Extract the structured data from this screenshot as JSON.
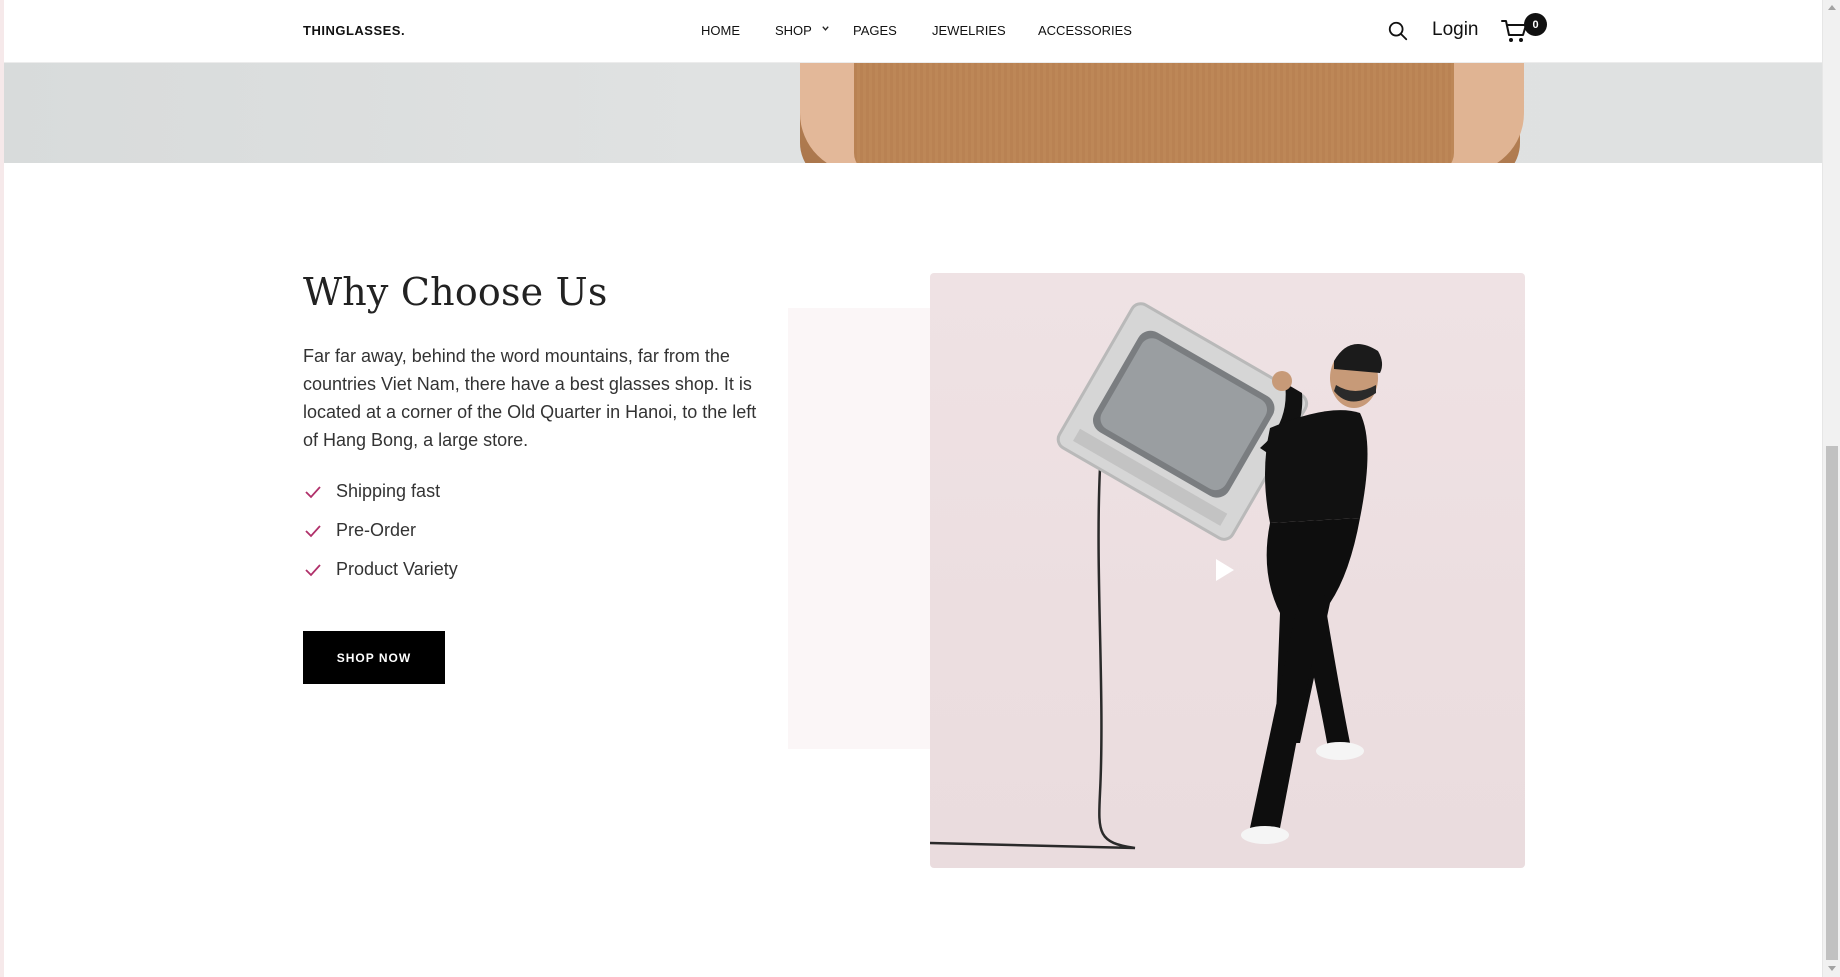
{
  "header": {
    "logo": "THINGLASSES.",
    "nav": [
      "HOME",
      "SHOP",
      "PAGES",
      "JEWELRIES",
      "ACCESSORIES"
    ],
    "login_label": "Login",
    "cart_count": "0"
  },
  "why_choose_us": {
    "title": "Why Choose Us",
    "description": "Far far away, behind the word mountains, far from the countries Viet Nam, there have a best glasses shop. It is located at a corner of the Old Quarter in Hanoi, to the left of Hang Bong, a large store.",
    "features": [
      "Shipping fast",
      "Pre-Order",
      "Product Variety"
    ],
    "button_label": "SHOP NOW"
  },
  "icons": {
    "search": "search-icon",
    "cart": "cart-icon",
    "check": "check-icon",
    "play": "play-icon",
    "chevron": "chevron-down-icon"
  },
  "colors": {
    "accent_check": "#b0306a",
    "button_bg": "#000000",
    "video_bg": "#eddfe1"
  }
}
